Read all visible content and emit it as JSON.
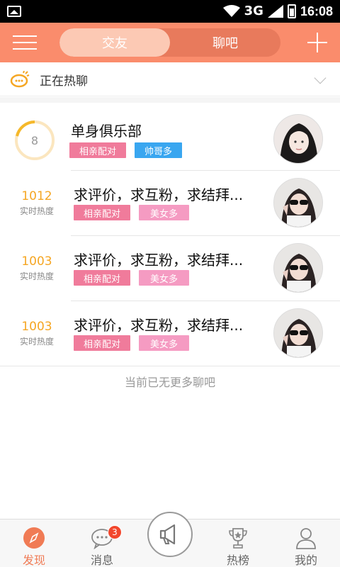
{
  "status_bar": {
    "network": "3G",
    "time": "16:08"
  },
  "header": {
    "tabs": [
      {
        "label": "交友",
        "active": true
      },
      {
        "label": "聊吧",
        "active": false
      }
    ]
  },
  "hot_bar": {
    "label": "正在热聊"
  },
  "featured": {
    "ring_value": "8",
    "title": "单身俱乐部",
    "tags": [
      "相亲配对",
      "帅哥多"
    ]
  },
  "rooms": [
    {
      "heat": "1012",
      "heat_label": "实时热度",
      "title": "求评价，求互粉，求结拜...",
      "tags": [
        "相亲配对",
        "美女多"
      ]
    },
    {
      "heat": "1003",
      "heat_label": "实时热度",
      "title": "求评价，求互粉，求结拜...",
      "tags": [
        "相亲配对",
        "美女多"
      ]
    },
    {
      "heat": "1003",
      "heat_label": "实时热度",
      "title": "求评价，求互粉，求结拜...",
      "tags": [
        "相亲配对",
        "美女多"
      ]
    }
  ],
  "list_footer": "当前已无更多聊吧",
  "bottom_nav": {
    "items": [
      {
        "label": "发现",
        "icon": "compass-icon",
        "active": true
      },
      {
        "label": "消息",
        "icon": "chat-bubble-icon",
        "badge": "3"
      },
      {
        "label": "热榜",
        "icon": "trophy-icon"
      },
      {
        "label": "我的",
        "icon": "person-icon"
      }
    ],
    "center_icon": "megaphone-icon"
  },
  "colors": {
    "header": "#fa8c6c",
    "accent": "#f07b55",
    "heat": "#f5a623",
    "tag_pink": "#f07b9b",
    "tag_lightpink": "#f59bc2",
    "tag_blue": "#39a6f0"
  }
}
